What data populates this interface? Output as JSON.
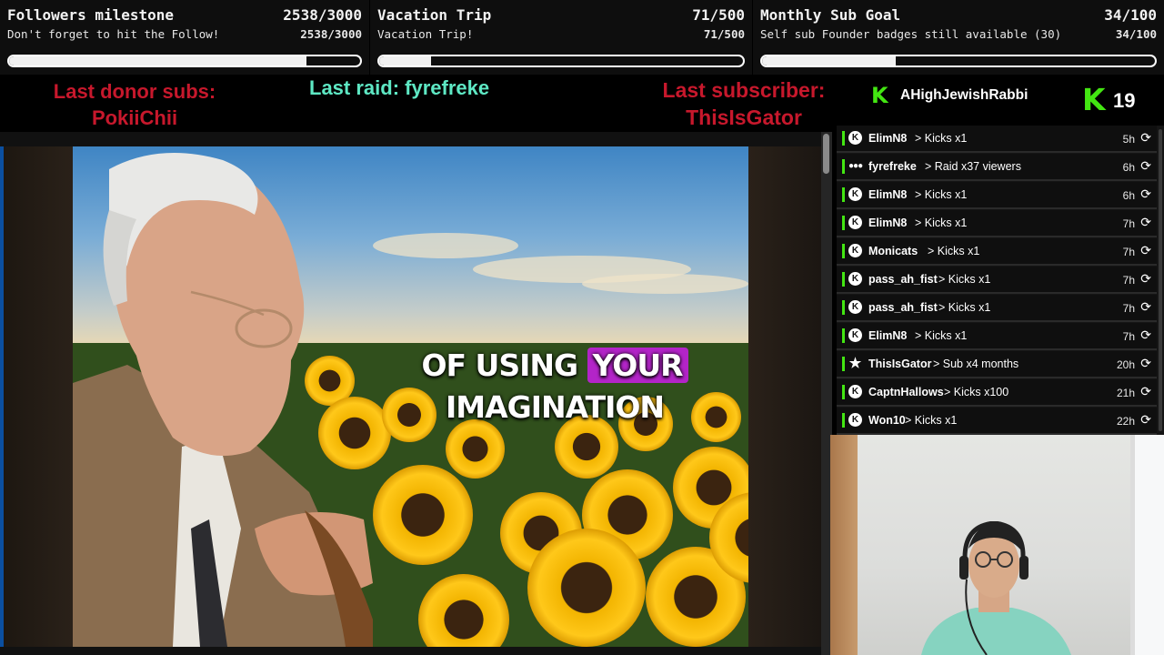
{
  "goals": [
    {
      "title": "Followers milestone",
      "count": "2538/3000",
      "subtitle": "Don't forget to hit the Follow!",
      "subcount": "2538/3000",
      "progress": 0.846
    },
    {
      "title": "Vacation Trip",
      "count": "71/500",
      "subtitle": "Vacation Trip!",
      "subcount": "71/500",
      "progress": 0.142
    },
    {
      "title": "Monthly Sub Goal",
      "count": "34/100",
      "subtitle": "Self sub Founder badges still available (30)",
      "subcount": "34/100",
      "progress": 0.34
    }
  ],
  "strip": {
    "donor_label": "Last donor subs:",
    "donor_name": "PokiiChii",
    "raid": "Last raid: fyrefreke",
    "sub_label": "Last subscriber:",
    "sub_name": "ThisIsGator"
  },
  "kick": {
    "username": "AHighJewishRabbi",
    "viewer_count": "19",
    "logo_letter": "K",
    "accent": "#43e612"
  },
  "feed": [
    {
      "user": "ElimN8",
      "action": "> Kicks x1",
      "time": "5h",
      "icon": "kick-icon"
    },
    {
      "user": "fyrefreke",
      "action": "> Raid x37 viewers",
      "time": "6h",
      "icon": "raid-icon"
    },
    {
      "user": "ElimN8",
      "action": "> Kicks x1",
      "time": "6h",
      "icon": "kick-icon"
    },
    {
      "user": "ElimN8",
      "action": "> Kicks x1",
      "time": "7h",
      "icon": "kick-icon"
    },
    {
      "user": "Monicats",
      "action": "> Kicks x1",
      "time": "7h",
      "icon": "kick-icon"
    },
    {
      "user": "pass_ah_fist",
      "action": "> Kicks x1",
      "time": "7h",
      "icon": "kick-icon"
    },
    {
      "user": "pass_ah_fist",
      "action": "> Kicks x1",
      "time": "7h",
      "icon": "kick-icon"
    },
    {
      "user": "ElimN8",
      "action": "> Kicks x1",
      "time": "7h",
      "icon": "kick-icon"
    },
    {
      "user": "ThisIsGator",
      "action": "> Sub x4 months",
      "time": "20h",
      "icon": "star-icon"
    },
    {
      "user": "CaptnHallows",
      "action": "> Kicks x100",
      "time": "21h",
      "icon": "kick-icon"
    },
    {
      "user": "Won10",
      "action": "> Kicks x1",
      "time": "22h",
      "icon": "kick-icon"
    }
  ],
  "video": {
    "caption_line1_a": "OF USING",
    "caption_line1_b": "YOUR",
    "caption_line2": "IMAGINATION"
  },
  "colors": {
    "donor_red": "#c7182c",
    "raid_teal": "#5ee8c4",
    "highlight_purple": "#b324c8"
  }
}
